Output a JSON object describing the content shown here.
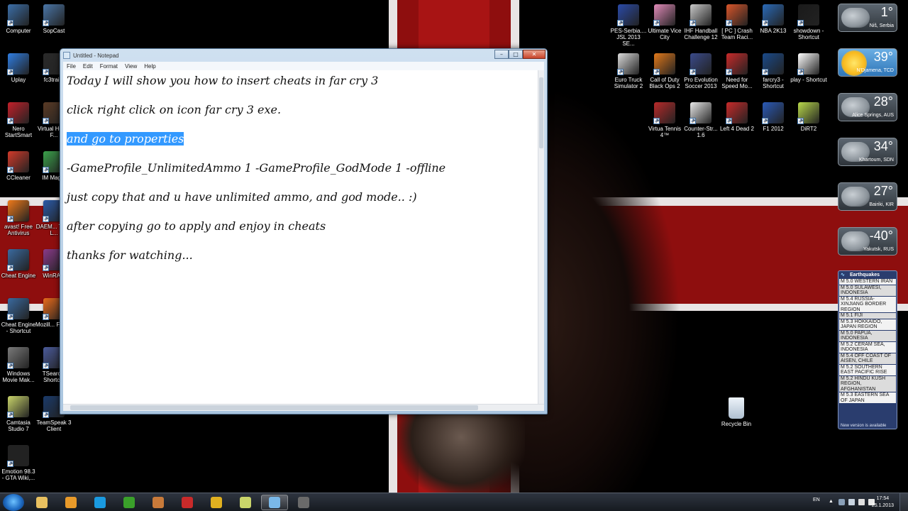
{
  "notepad": {
    "title": "Untitled - Notepad",
    "menu": [
      "File",
      "Edit",
      "Format",
      "View",
      "Help"
    ],
    "lines": [
      "Today I will show you how to insert cheats in far cry 3",
      "click right click on icon far cry 3 exe.",
      "and go to properties",
      "-GameProfile_UnlimitedAmmo 1 -GameProfile_GodMode 1 -offline",
      "just copy that and u have unlimited ammo, and god mode.. :)",
      "after copying go to apply and enjoy in cheats",
      "thanks for watching..."
    ],
    "selected_line": "and go to properties",
    "selection_color": "#3399ff"
  },
  "desktop_left": [
    {
      "label": "Computer",
      "icon": "computer-icon",
      "color": "#3b6ea8"
    },
    {
      "label": "SopCast",
      "icon": "sopcast-icon",
      "color": "#4a76a8"
    },
    {
      "label": "Uplay",
      "icon": "uplay-icon",
      "color": "#2f7de1"
    },
    {
      "label": "fc3trai...",
      "icon": "fc3-trainer-icon",
      "color": "#2a2a2a"
    },
    {
      "label": "Nero StartSmart",
      "icon": "nero-icon",
      "color": "#c3202a"
    },
    {
      "label": "Virtual Home F...",
      "icon": "virtual-home-icon",
      "color": "#5a3a24"
    },
    {
      "label": "CCleaner",
      "icon": "ccleaner-icon",
      "color": "#d23a2a"
    },
    {
      "label": "IM Mag...",
      "icon": "im-magic-icon",
      "color": "#3aa04a"
    },
    {
      "label": "avast! Free Antivirus",
      "icon": "avast-icon",
      "color": "#f07a1a"
    },
    {
      "label": "DAEM... Tools L...",
      "icon": "daemon-tools-icon",
      "color": "#2a5aa8"
    },
    {
      "label": "Cheat Engine",
      "icon": "cheat-engine-icon",
      "color": "#3a6aa0"
    },
    {
      "label": "WinRA...",
      "icon": "winrar-icon",
      "color": "#8a3a8a"
    },
    {
      "label": "Cheat Engine - Shortcut",
      "icon": "cheat-engine-shortcut-icon",
      "color": "#3a6aa0"
    },
    {
      "label": "Mozill... Firef...",
      "icon": "firefox-icon",
      "color": "#e86a1a"
    },
    {
      "label": "Windows Movie Mak...",
      "icon": "movie-maker-icon",
      "color": "#7a7a7a"
    },
    {
      "label": "TSearc... Shortc...",
      "icon": "tsearch-icon",
      "color": "#4a5a9a"
    },
    {
      "label": "Camtasia Studio 7",
      "icon": "camtasia-icon",
      "color": "#c9d46a"
    },
    {
      "label": "TeamSpeak 3 Client",
      "icon": "teamspeak-icon",
      "color": "#1a3a6a"
    },
    {
      "label": "Emotion 98.3 - GTA Wiki,...",
      "icon": "emotion-icon",
      "color": "#222222"
    }
  ],
  "desktop_right": [
    {
      "label": "PES-Serbia.... JSL 2013 SE...",
      "icon": "pes-icon",
      "color": "#2a4aa8"
    },
    {
      "label": "Ultimate Vice City",
      "icon": "vice-city-icon",
      "color": "#e08ab8"
    },
    {
      "label": "IHF Handball Challenge 12",
      "icon": "ihf-handball-icon",
      "color": "#c8c8c8"
    },
    {
      "label": "[ PC ] Crash Team Raci...",
      "icon": "crash-team-icon",
      "color": "#d8552a"
    },
    {
      "label": "NBA 2K13",
      "icon": "nba-icon",
      "color": "#2a6ab8"
    },
    {
      "label": "showdown - Shortcut",
      "icon": "showdown-icon",
      "color": "#1a1a1a"
    },
    {
      "label": "Euro Truck Simulator 2",
      "icon": "euro-truck-icon",
      "color": "#dadada"
    },
    {
      "label": "Call of Duty Black Ops 2",
      "icon": "cod-icon",
      "color": "#e0781a"
    },
    {
      "label": "Pro Evolution Soccer 2013",
      "icon": "pes2013-icon",
      "color": "#3a4a8a"
    },
    {
      "label": "Need for Speed Mo...",
      "icon": "nfs-icon",
      "color": "#c82a2a"
    },
    {
      "label": "farcry3 - Shortcut",
      "icon": "farcry3-icon",
      "color": "#1a4a8a"
    },
    {
      "label": "play - Shortcut",
      "icon": "play-icon",
      "color": "#ffffff"
    },
    {
      "label": "Virtua Tennis 4™",
      "icon": "virtua-tennis-icon",
      "color": "#b82a2a"
    },
    {
      "label": "Counter-Str... 1.6",
      "icon": "counter-strike-icon",
      "color": "#e8e8e8"
    },
    {
      "label": "Left 4 Dead 2",
      "icon": "l4d2-icon",
      "color": "#c82a2a"
    },
    {
      "label": "F1 2012",
      "icon": "f1-icon",
      "color": "#2a5ab8"
    },
    {
      "label": "DiRT2",
      "icon": "dirt2-icon",
      "color": "#b8d84a"
    }
  ],
  "recycle_bin": {
    "label": "Recycle Bin",
    "icon": "recycle-bin-icon"
  },
  "weather": [
    {
      "temp": "1°",
      "city": "Niš, Serbia",
      "style": "cloudy"
    },
    {
      "temp": "39°",
      "city": "N'Djamena, TCD",
      "style": "sunny"
    },
    {
      "temp": "28°",
      "city": "Alice Springs, AUS",
      "style": "cloudy"
    },
    {
      "temp": "34°",
      "city": "Khartoum, SDN",
      "style": "cloudy"
    },
    {
      "temp": "27°",
      "city": "Bairiki, KIR",
      "style": "cloudy"
    },
    {
      "temp": "-40°",
      "city": "Yakutsk, RUS",
      "style": "cloudy"
    }
  ],
  "earthquakes": {
    "title": "Earthquakes",
    "items": [
      "M 5.0 WESTERN IRAN",
      "M 5.0 SULAWESI, INDONESIA",
      "M 5.4 RUSSIA-XINJIANG BORDER REGION",
      "M 5.1 FIJI",
      "M 5.3 HOKKAIDO, JAPAN REGION",
      "M 5.0 PAPUA, INDONESIA",
      "M 5.2 CERAM SEA, INDONESIA",
      "M 5.4 OFF COAST OF AISEN, CHILE",
      "M 5.2 SOUTHERN EAST PACIFIC RISE",
      "M 5.2 HINDU KUSH REGION, AFGHANISTAN",
      "M 5.3 EASTERN SEA OF JAPAN"
    ],
    "footer": "New version is available"
  },
  "taskbar": {
    "apps": [
      {
        "name": "explorer",
        "icon": "folder-icon",
        "color": "#e8c060"
      },
      {
        "name": "media-player",
        "icon": "media-player-icon",
        "color": "#e89a2a"
      },
      {
        "name": "skype",
        "icon": "skype-icon",
        "color": "#1a9ae0"
      },
      {
        "name": "utorrent",
        "icon": "utorrent-icon",
        "color": "#3aa02a"
      },
      {
        "name": "tool",
        "icon": "tool-icon",
        "color": "#c87a3a"
      },
      {
        "name": "recorder",
        "icon": "recorder-icon",
        "color": "#c82a2a"
      },
      {
        "name": "chrome",
        "icon": "chrome-icon",
        "color": "#e0b020"
      },
      {
        "name": "camtasia",
        "icon": "camtasia-taskbar-icon",
        "color": "#c9d46a"
      },
      {
        "name": "notepad",
        "icon": "notepad-icon",
        "color": "#7ab8e8"
      },
      {
        "name": "game",
        "icon": "game-icon",
        "color": "#6a6a6a"
      }
    ],
    "language": "EN",
    "time": "17:54",
    "date": "25.1.2013"
  }
}
